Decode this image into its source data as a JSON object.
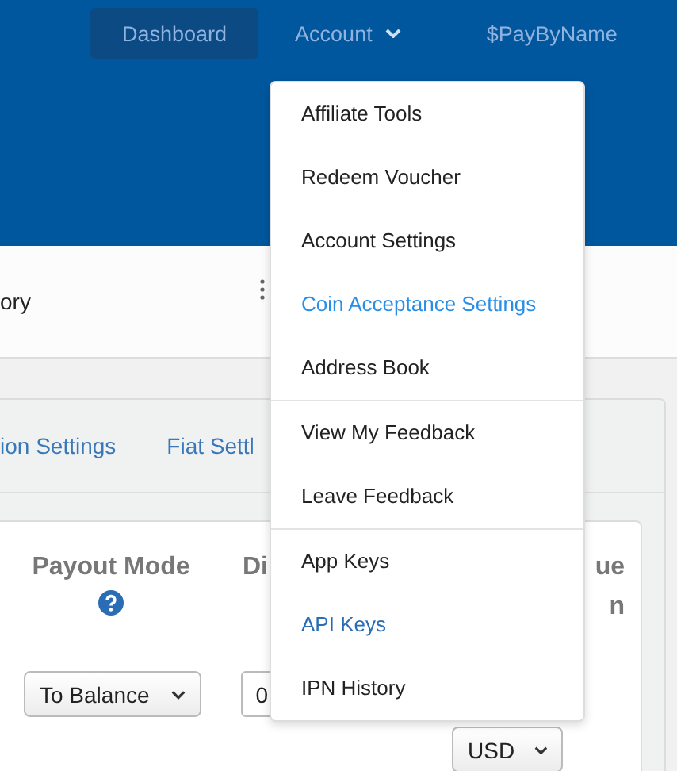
{
  "nav": {
    "items": [
      {
        "label": "Dashboard",
        "selected": true
      },
      {
        "label": "Account",
        "selected": false,
        "dropdown": true
      },
      {
        "label": "$PayByName",
        "selected": false
      }
    ]
  },
  "subbar": {
    "label": "ory"
  },
  "tabs": [
    {
      "label": "ion Settings"
    },
    {
      "label": "Fiat Settl"
    }
  ],
  "table": {
    "columns": [
      {
        "lines": [
          "Payout Mode"
        ],
        "help": true
      },
      {
        "lines": [
          "Di"
        ]
      },
      {
        "lines": [
          "ue",
          "n"
        ]
      }
    ],
    "row": {
      "payout_mode": "To Balance",
      "column_2": "0",
      "currency": "USD"
    }
  },
  "menu": {
    "groups": [
      [
        {
          "label": "Affiliate Tools",
          "color": "#222222"
        },
        {
          "label": "Redeem Voucher",
          "color": "#222222"
        },
        {
          "label": "Account Settings",
          "color": "#222222"
        },
        {
          "label": "Coin Acceptance Settings",
          "color": "#2a8ee6"
        },
        {
          "label": "Address Book",
          "color": "#222222"
        }
      ],
      [
        {
          "label": "View My Feedback",
          "color": "#222222"
        },
        {
          "label": "Leave Feedback",
          "color": "#222222"
        }
      ],
      [
        {
          "label": "App Keys",
          "color": "#222222"
        },
        {
          "label": "API Keys",
          "color": "#2a6db5"
        },
        {
          "label": "IPN History",
          "color": "#222222"
        }
      ]
    ]
  }
}
